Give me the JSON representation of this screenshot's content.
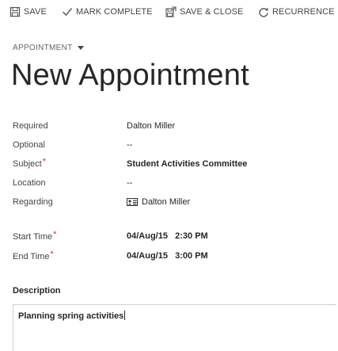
{
  "toolbar": {
    "save_label": "SAVE",
    "mark_complete_label": "MARK COMPLETE",
    "save_close_label": "SAVE & CLOSE",
    "recurrence_label": "RECURRENCE"
  },
  "header": {
    "entity_label": "APPOINTMENT",
    "title": "New Appointment"
  },
  "fields": {
    "required": {
      "label": "Required",
      "value": "Dalton Miller"
    },
    "optional": {
      "label": "Optional",
      "value": "--"
    },
    "subject": {
      "label": "Subject",
      "required_marker": "*",
      "value": "Student Activities Committee"
    },
    "location": {
      "label": "Location",
      "value": "--"
    },
    "regarding": {
      "label": "Regarding",
      "value": "Dalton Miller"
    },
    "start_time": {
      "label": "Start Time",
      "required_marker": "*",
      "date": "04/Aug/15",
      "time": "2:30 PM"
    },
    "end_time": {
      "label": "End Time",
      "required_marker": "*",
      "date": "04/Aug/15",
      "time": "3:00 PM"
    }
  },
  "description": {
    "title": "Description",
    "value": "Planning spring activities"
  },
  "colors": {
    "required_marker": "#c0392b",
    "text": "#262626",
    "label": "#444444"
  }
}
